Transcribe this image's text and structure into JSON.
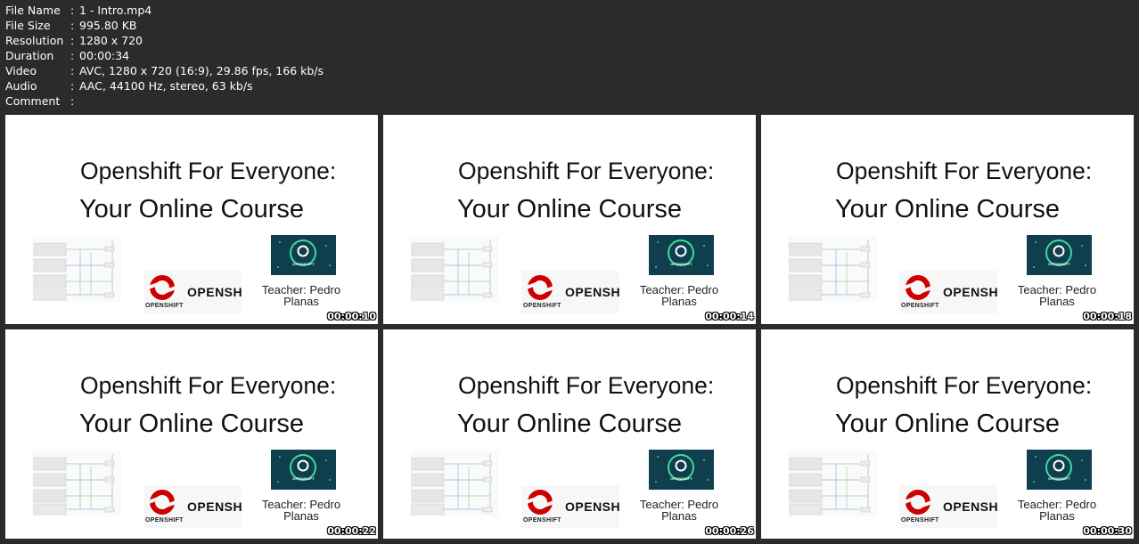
{
  "meta": [
    {
      "label": "File Name",
      "value": "1 - Intro.mp4"
    },
    {
      "label": "File Size",
      "value": "995.80 KB"
    },
    {
      "label": "Resolution",
      "value": "1280 x 720"
    },
    {
      "label": "Duration",
      "value": "00:00:34"
    },
    {
      "label": "Video",
      "value": "AVC, 1280 x 720 (16:9), 29.86 fps, 166 kb/s"
    },
    {
      "label": "Audio",
      "value": "AAC, 44100 Hz, stereo, 63 kb/s"
    },
    {
      "label": "Comment",
      "value": ""
    }
  ],
  "separator": ":",
  "slide": {
    "title_line1": "Openshift For Everyone:",
    "title_line2": "Your Online Course",
    "teacher": "Teacher: Pedro Planas",
    "logo_word": "OPENSH",
    "logo_small": "OPENSHIFT",
    "card_label": "OPENSHIFT"
  },
  "thumbnails": [
    {
      "timestamp": "00:00:10"
    },
    {
      "timestamp": "00:00:14"
    },
    {
      "timestamp": "00:00:18"
    },
    {
      "timestamp": "00:00:22"
    },
    {
      "timestamp": "00:00:26"
    },
    {
      "timestamp": "00:00:30"
    }
  ],
  "colors": {
    "background": "#2b2b2b",
    "redhat_red": "#cc0000",
    "card_teal": "#0f3f4f",
    "card_ring": "#3ddc97"
  }
}
